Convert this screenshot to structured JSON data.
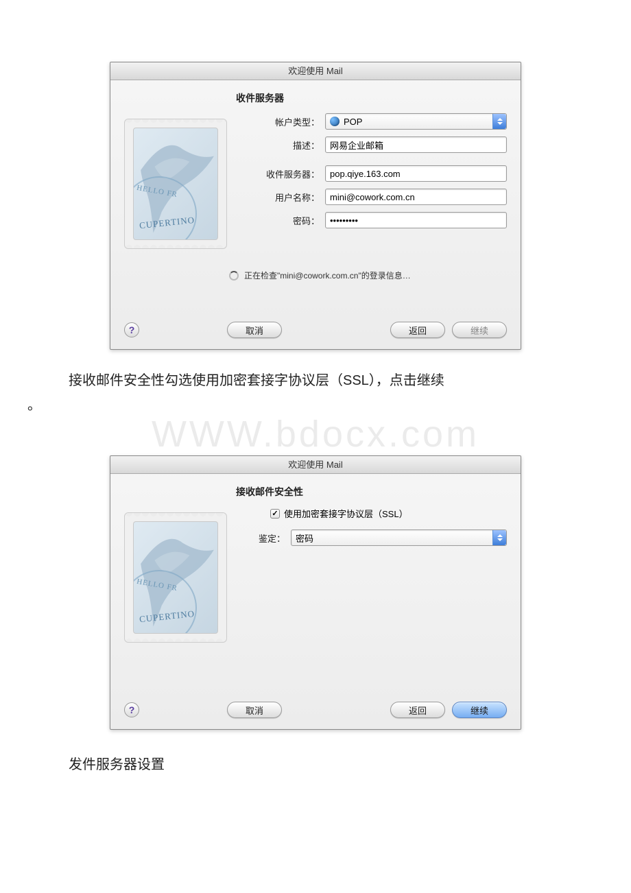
{
  "dialog1": {
    "window_title": "欢迎使用 Mail",
    "sheet_title": "收件服务器",
    "labels": {
      "account_type": "帐户类型：",
      "description": "描述：",
      "incoming_server": "收件服务器：",
      "username": "用户名称：",
      "password": "密码："
    },
    "values": {
      "account_type": "POP",
      "description": "网易企业邮箱",
      "incoming_server": "pop.qiye.163.com",
      "username": "mini@cowork.com.cn",
      "password": "•••••••••"
    },
    "status_text": "正在检查\"mini@cowork.com.cn\"的登录信息…",
    "buttons": {
      "help": "?",
      "cancel": "取消",
      "back": "返回",
      "continue": "继续"
    },
    "stamp": {
      "top_text": "HELLO FR",
      "bottom_text": "CUPERTINO"
    }
  },
  "caption1_line1": "接收邮件安全性勾选使用加密套接字协议层（SSL），点击继续",
  "caption1_line2": "。",
  "watermark": "WWW.bdocx.com",
  "dialog2": {
    "window_title": "欢迎使用 Mail",
    "sheet_title": "接收邮件安全性",
    "ssl_checkbox_label": "使用加密套接字协议层（SSL）",
    "ssl_checked": true,
    "auth_label": "鉴定：",
    "auth_value": "密码",
    "buttons": {
      "help": "?",
      "cancel": "取消",
      "back": "返回",
      "continue": "继续"
    },
    "stamp": {
      "top_text": "HELLO FR",
      "bottom_text": "CUPERTINO"
    }
  },
  "caption2": "发件服务器设置"
}
